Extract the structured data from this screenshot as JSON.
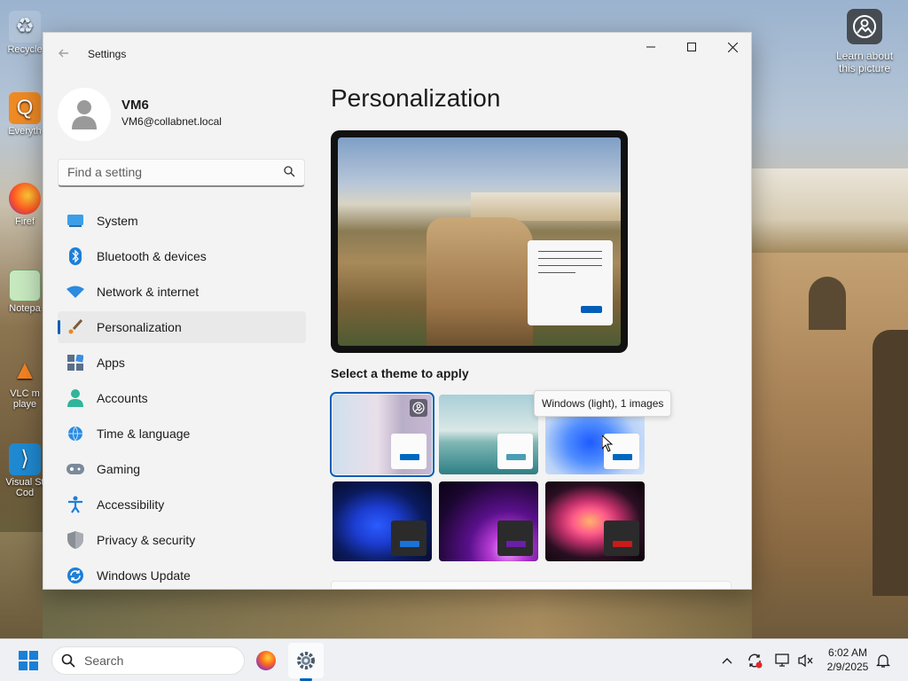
{
  "desktop": {
    "icons": [
      {
        "label": "Recycle",
        "name": "recycle-bin"
      },
      {
        "label": "Everyth",
        "name": "everything"
      },
      {
        "label": "Firef",
        "name": "firefox"
      },
      {
        "label": "Notepa",
        "name": "notepad"
      },
      {
        "label": "VLC m playe",
        "name": "vlc"
      },
      {
        "label": "Visual St Cod",
        "name": "vscode"
      }
    ],
    "learn_widget": {
      "label": "Learn about this picture",
      "icon": "camera-icon"
    }
  },
  "window": {
    "title": "Settings",
    "controls": {
      "minimize": "minimize-icon",
      "maximize": "maximize-icon",
      "close": "close-icon"
    }
  },
  "profile": {
    "name": "VM6",
    "email": "VM6@collabnet.local"
  },
  "search": {
    "placeholder": "Find a setting"
  },
  "nav": {
    "items": [
      {
        "label": "System",
        "icon": "system-icon"
      },
      {
        "label": "Bluetooth & devices",
        "icon": "bluetooth-icon"
      },
      {
        "label": "Network & internet",
        "icon": "wifi-icon"
      },
      {
        "label": "Personalization",
        "icon": "brush-icon",
        "active": true
      },
      {
        "label": "Apps",
        "icon": "apps-icon"
      },
      {
        "label": "Accounts",
        "icon": "accounts-icon"
      },
      {
        "label": "Time & language",
        "icon": "globe-icon"
      },
      {
        "label": "Gaming",
        "icon": "gamepad-icon"
      },
      {
        "label": "Accessibility",
        "icon": "accessibility-icon"
      },
      {
        "label": "Privacy & security",
        "icon": "shield-icon"
      },
      {
        "label": "Windows Update",
        "icon": "update-icon"
      }
    ]
  },
  "content": {
    "title": "Personalization",
    "theme_section_label": "Select a theme to apply",
    "tooltip": "Windows (light), 1 images",
    "themes": [
      {
        "name": "spotlight",
        "accent": "#0067c0",
        "selected": true
      },
      {
        "name": "glow-lake",
        "accent": "#4a9eb4"
      },
      {
        "name": "windows-light",
        "accent": "#0067c0"
      },
      {
        "name": "windows-dark",
        "accent": "#1a73d9"
      },
      {
        "name": "sunrise",
        "accent": "#6a1fa8"
      },
      {
        "name": "flow",
        "accent": "#c81a1a"
      }
    ]
  },
  "taskbar": {
    "search_label": "Search",
    "time": "6:02 AM",
    "date": "2/9/2025",
    "accent": "#005fb8"
  }
}
